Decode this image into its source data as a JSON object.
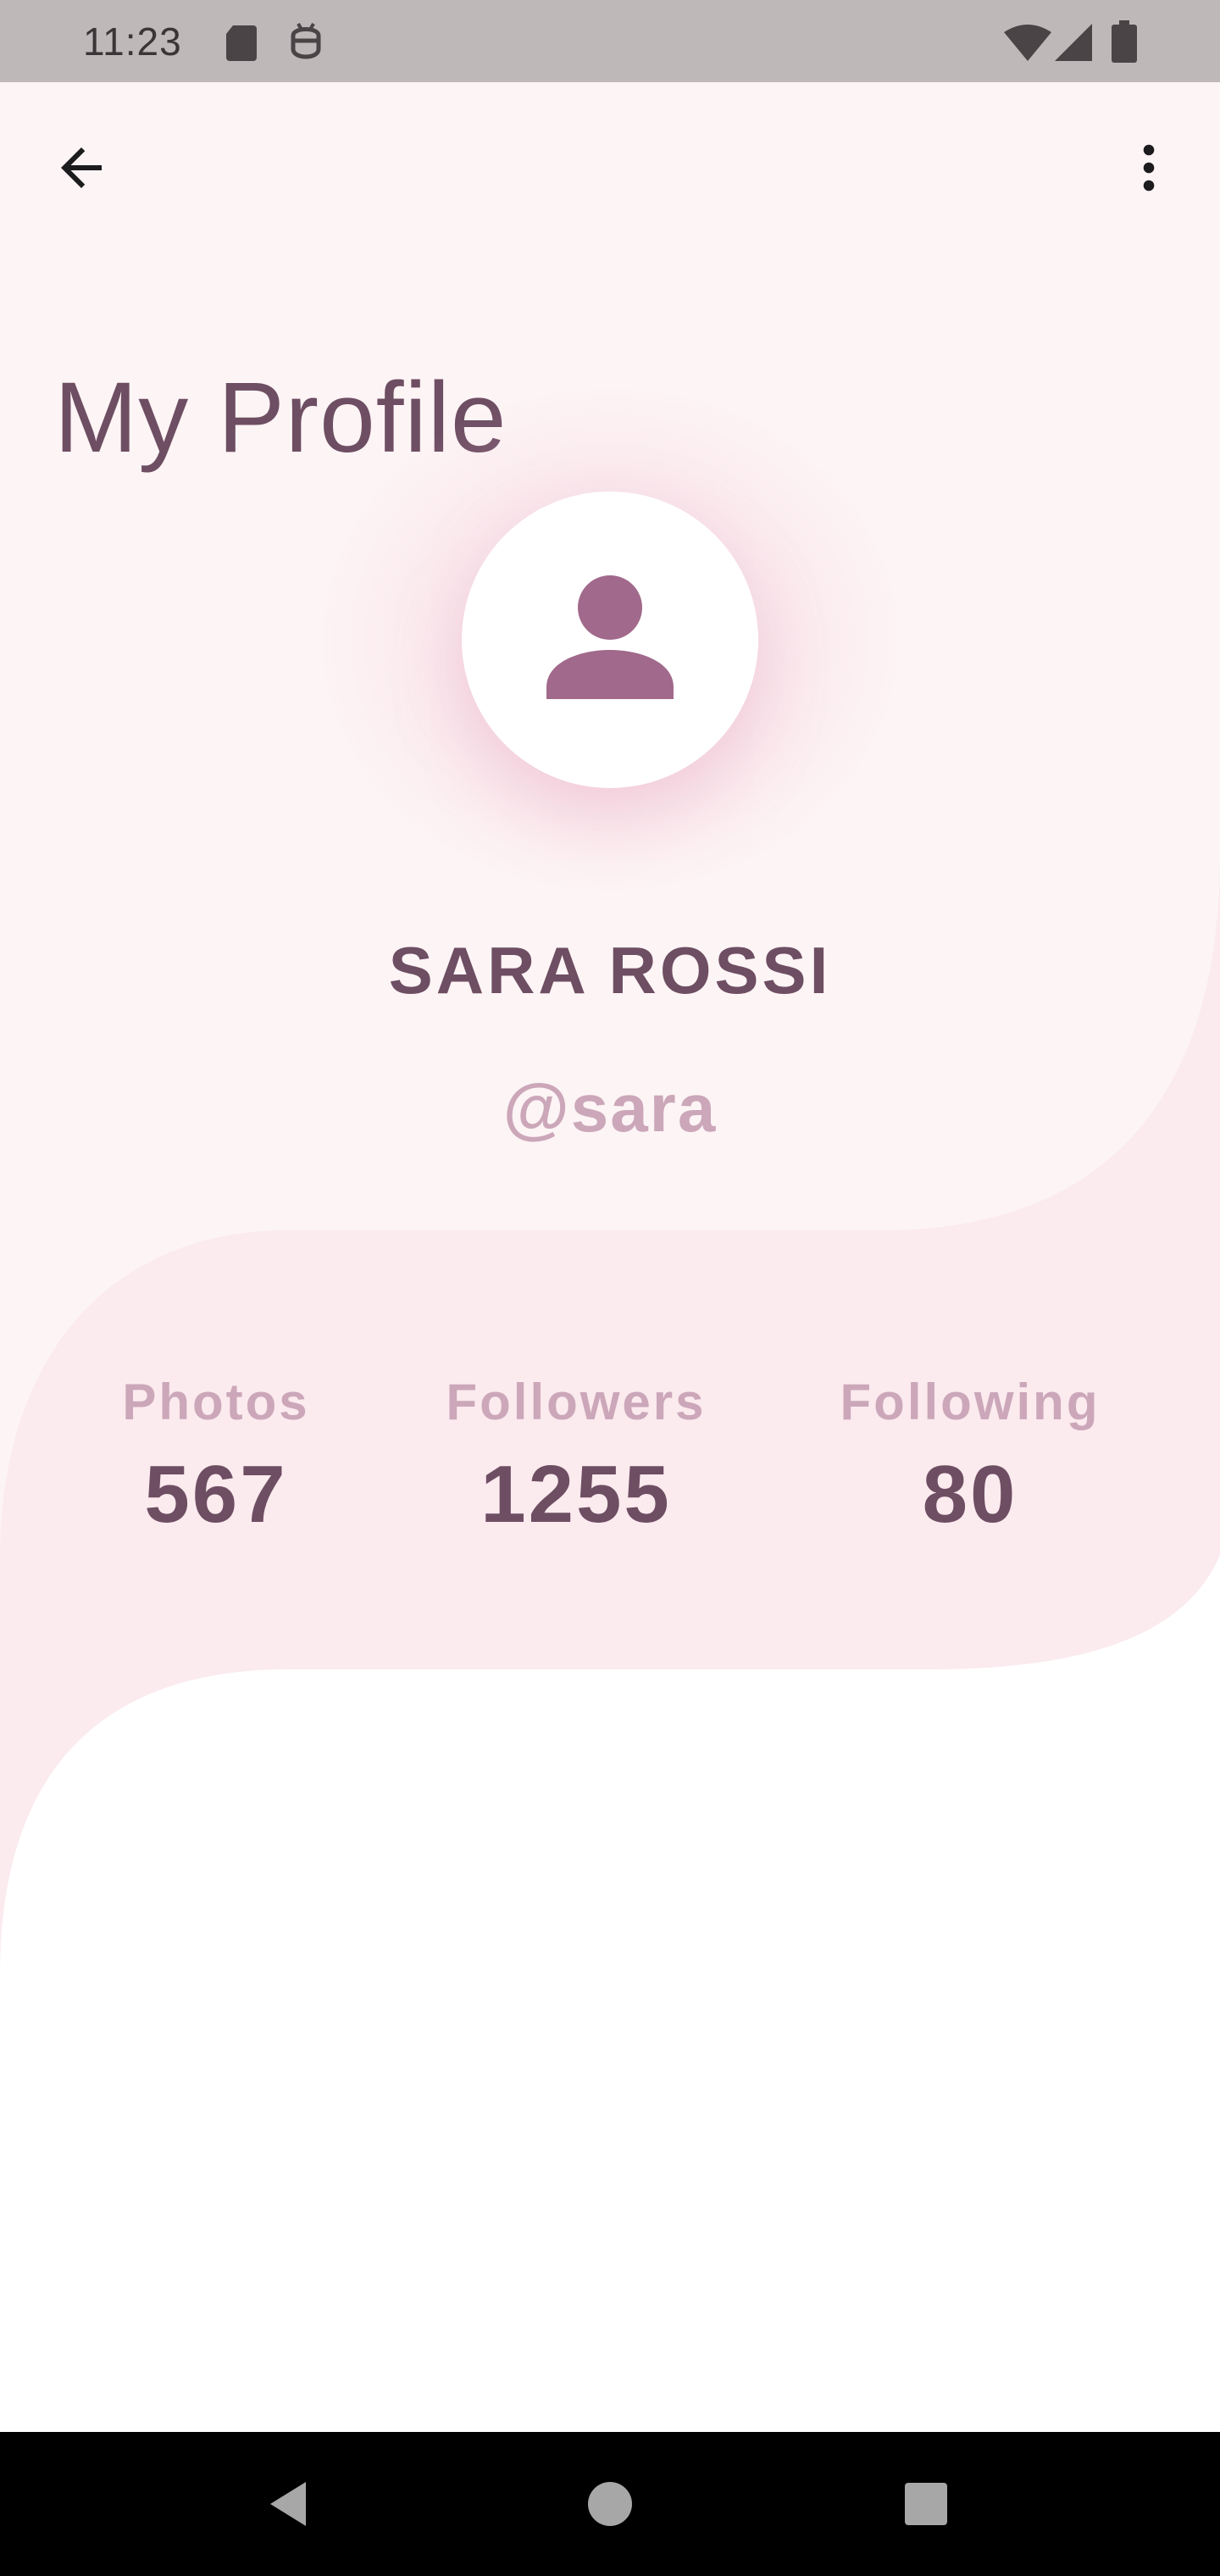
{
  "status_bar": {
    "time": "11:23",
    "icons": [
      "sd-card-icon",
      "android-debug-icon",
      "wifi-icon",
      "cellular-signal-icon",
      "battery-icon"
    ]
  },
  "app_bar": {
    "back_icon": "arrow-back-icon",
    "menu_icon": "more-vert-icon"
  },
  "page": {
    "title": "My Profile"
  },
  "profile": {
    "avatar_icon": "person-icon",
    "name": "SARA ROSSI",
    "handle": "@sara"
  },
  "stats": [
    {
      "label": "Photos",
      "value": "567"
    },
    {
      "label": "Followers",
      "value": "1255"
    },
    {
      "label": "Following",
      "value": "80"
    }
  ],
  "nav_bar": {
    "icons": [
      "back-triangle-icon",
      "home-circle-icon",
      "recents-square-icon"
    ]
  },
  "colors": {
    "accent": "#a1698b",
    "title": "#6e4e63",
    "muted": "#cba7b9",
    "bg_top": "#fdf4f5",
    "bg_middle": "#fbeaee"
  }
}
